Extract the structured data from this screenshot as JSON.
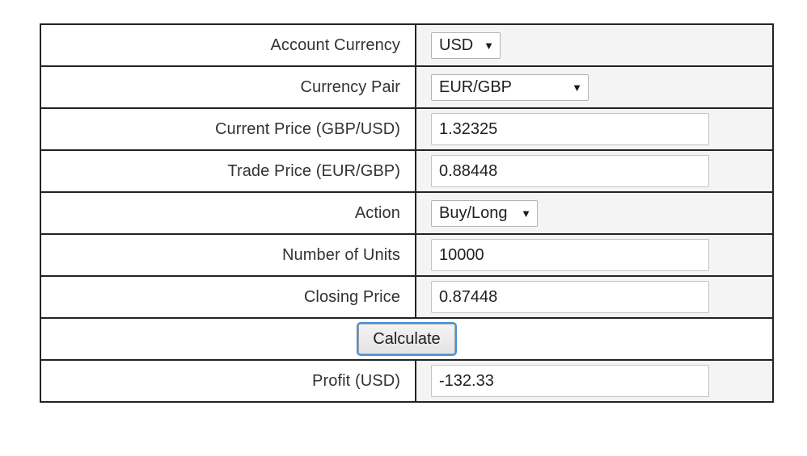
{
  "form": {
    "rows": [
      {
        "label": "Account Currency",
        "control": "select",
        "value": "USD",
        "arrow": "▼",
        "width": "narrow",
        "name": "account-currency"
      },
      {
        "label": "Currency Pair",
        "control": "select",
        "value": "EUR/GBP",
        "arrow": "▼",
        "width": "wide",
        "name": "currency-pair"
      },
      {
        "label": "Current Price (GBP/USD)",
        "control": "input",
        "value": "1.32325",
        "placeholder": "",
        "name": "current-price"
      },
      {
        "label": "Trade Price (EUR/GBP)",
        "control": "input",
        "value": "0.88448",
        "placeholder": "",
        "name": "trade-price"
      },
      {
        "label": "Action",
        "control": "select",
        "value": "Buy/Long",
        "arrow": "▼",
        "width": "mid",
        "name": "action"
      },
      {
        "label": "Number of Units",
        "control": "input",
        "value": "10000",
        "placeholder": "",
        "name": "number-of-units"
      },
      {
        "label": "Closing Price",
        "control": "input",
        "value": "0.87448",
        "placeholder": "",
        "name": "closing-price"
      }
    ],
    "calculate_label": "Calculate",
    "result": {
      "label": "Profit (USD)",
      "value": "-132.33",
      "placeholder": ""
    }
  },
  "colors": {
    "border": "#232323",
    "field_cell_bg": "#f4f4f4",
    "label_cell_bg": "#ffffff",
    "focus_ring": "#4a90e2",
    "text": "#333333"
  }
}
